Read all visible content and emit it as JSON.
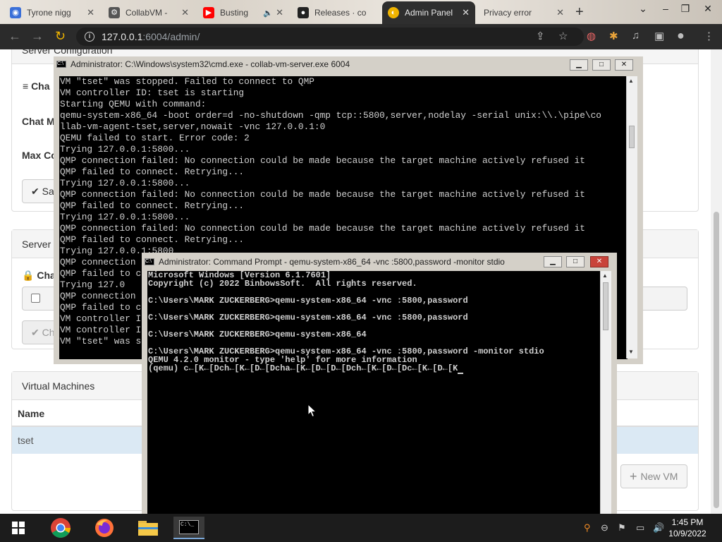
{
  "browser": {
    "tabs": [
      {
        "title": "Tyrone nigg",
        "icon": "blue-favicon-icon",
        "color": "#3a6fd8"
      },
      {
        "title": "CollabVM -",
        "icon": "collabvm-icon",
        "color": "#333333"
      },
      {
        "title": "Busting",
        "icon": "youtube-icon",
        "color": "#ff0000"
      },
      {
        "title": "Releases · co",
        "icon": "github-icon",
        "color": "#222222"
      },
      {
        "title": "Admin Panel",
        "icon": "admin-panel-favicon-icon",
        "color": "#f0b400"
      },
      {
        "title": "Privacy error",
        "icon": "warning-icon",
        "color": "#888888"
      }
    ],
    "url_host": "127.0.0.1",
    "url_rest": ":6004/admin/"
  },
  "admin": {
    "server_configuration_title": "Server Configuration",
    "chat_settings_label": "Cha",
    "chat_mute_label": "Chat M",
    "max_connections_label": "Max Co",
    "save_button_label": "Sa",
    "server_panel_title": "Server",
    "change_password_label": "Cha",
    "change_button_label": "Ch",
    "vm_panel_title": "Virtual Machines",
    "table_header_name": "Name",
    "vm_rows": [
      {
        "name": "tset"
      }
    ],
    "new_vm_label": "New VM"
  },
  "cmd_server": {
    "title": "Administrator: C:\\Windows\\system32\\cmd.exe - collab-vm-server.exe  6004",
    "lines": [
      "VM \"tset\" was stopped. Failed to connect to QMP",
      "VM controller ID: tset is starting",
      "Starting QEMU with command:",
      "qemu-system-x86_64 -boot order=d -no-shutdown -qmp tcp::5800,server,nodelay -serial unix:\\\\.\\pipe\\co",
      "llab-vm-agent-tset,server,nowait -vnc 127.0.0.1:0",
      "QEMU failed to start. Error code: 2",
      "Trying 127.0.0.1:5800...",
      "QMP connection failed: No connection could be made because the target machine actively refused it",
      "QMP failed to connect. Retrying...",
      "Trying 127.0.0.1:5800...",
      "QMP connection failed: No connection could be made because the target machine actively refused it",
      "QMP failed to connect. Retrying...",
      "Trying 127.0.0.1:5800...",
      "QMP connection failed: No connection could be made because the target machine actively refused it",
      "QMP failed to connect. Retrying...",
      "Trying 127.0.0.1:5800",
      "QMP connection",
      "QMP failed to c",
      "Trying 127.0",
      "QMP connection",
      "QMP failed to c",
      "VM controller I",
      "VM controller I",
      "VM \"tset\" was s"
    ]
  },
  "cmd_prompt": {
    "title": "Administrator: Command Prompt - qemu-system-x86_64  -vnc :5800,password -monitor stdio",
    "lines": [
      "Microsoft Windows [Version 6.1.7601]",
      "Copyright (c) 2022 BinbowsSoft.  All rights reserved.",
      "",
      "C:\\Users\\MARK ZUCKERBERG>qemu-system-x86_64 -vnc :5800,password",
      "",
      "C:\\Users\\MARK ZUCKERBERG>qemu-system-x86_64 -vnc :5800,password",
      "",
      "C:\\Users\\MARK ZUCKERBERG>qemu-system-x86_64",
      "",
      "C:\\Users\\MARK ZUCKERBERG>qemu-system-x86_64 -vnc :5800,password -monitor stdio",
      "QEMU 4.2.0 monitor - type 'help' for more information",
      "(qemu) c←[K←[Dch←[K←[D←[Dcha←[K←[D←[D←[Dch←[K←[D←[Dc←[K←[D←[K"
    ]
  },
  "taskbar": {
    "apps": [
      "start-button",
      "chrome",
      "firefox",
      "file-explorer",
      "command-prompt"
    ],
    "time": "1:45 PM",
    "date": "10/9/2022"
  }
}
